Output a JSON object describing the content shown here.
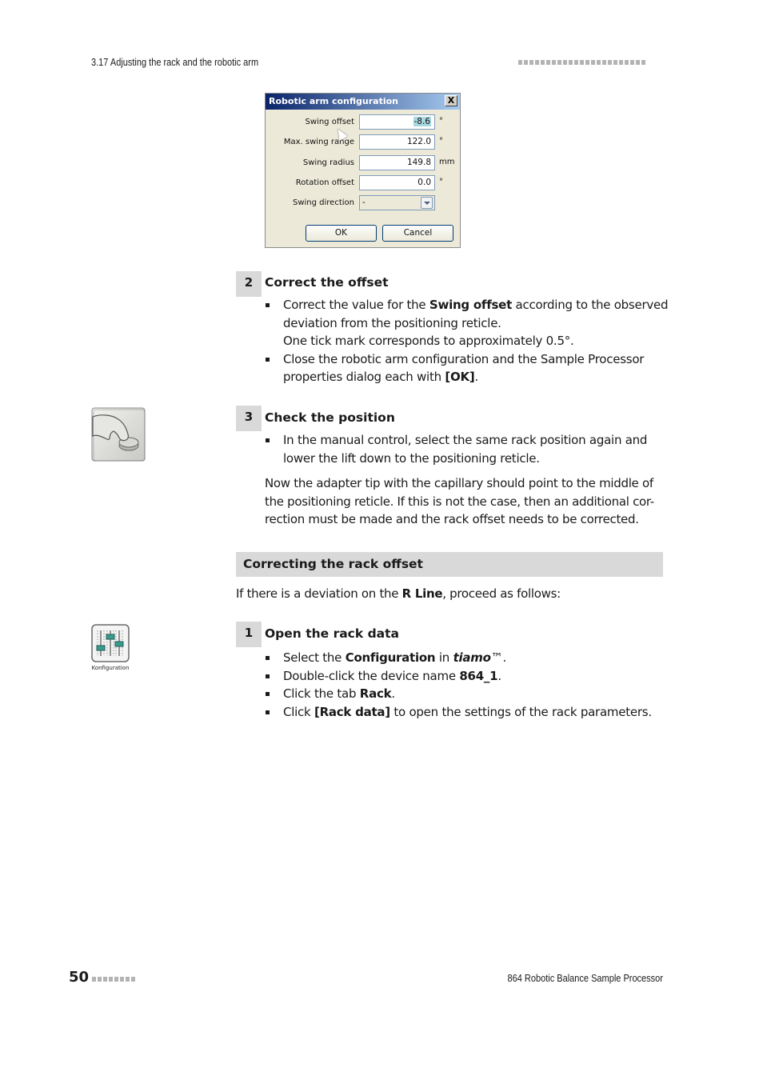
{
  "header": {
    "section_title": "3.17 Adjusting the rack and the robotic arm"
  },
  "dialog": {
    "title": "Robotic arm configuration",
    "close_label": "X",
    "fields": [
      {
        "label": "Swing offset",
        "value": "-8.6",
        "unit": "°",
        "selected": true
      },
      {
        "label": "Max. swing range",
        "value": "122.0",
        "unit": "°"
      },
      {
        "label": "Swing radius",
        "value": "149.8",
        "unit": "mm"
      },
      {
        "label": "Rotation offset",
        "value": "0.0",
        "unit": "°"
      }
    ],
    "swing_direction": {
      "label": "Swing direction",
      "value": "-"
    },
    "ok_label": "OK",
    "cancel_label": "Cancel"
  },
  "steps_a": [
    {
      "number": "2",
      "title": "Correct the offset",
      "bullets": [
        {
          "pre": "Correct the value for the ",
          "bold": "Swing offset",
          "post": " according to the observed deviation from the positioning reticle.",
          "line2": "One tick mark corresponds to approximately 0.5°."
        },
        {
          "pre": "Close the robotic arm configuration and the Sample Processor properties dialog each with ",
          "bold": "[OK]",
          "post": "."
        }
      ]
    },
    {
      "number": "3",
      "title": "Check the position",
      "bullets": [
        {
          "text": "In the manual control, select the same rack position again and lower the lift down to the positioning reticle."
        }
      ],
      "paragraph": "Now the adapter tip with the capillary should point to the middle of the positioning reticle. If this is not the case, then an additional cor-rection must be made and the rack offset needs to be corrected."
    }
  ],
  "section": {
    "title": "Correcting the rack offset",
    "intro_pre": "If there is a deviation on the ",
    "intro_bold": "R Line",
    "intro_post": ", proceed as follows:"
  },
  "steps_b": [
    {
      "number": "1",
      "title": "Open the rack data",
      "bullets": [
        {
          "pre": "Select the ",
          "bold": "Configuration",
          "mid": " in ",
          "bolditalic": "tiamo",
          "post": "™."
        },
        {
          "pre": "Double-click the device name ",
          "bold": "864_1",
          "post": "."
        },
        {
          "pre": "Click the tab ",
          "bold": "Rack",
          "post": "."
        },
        {
          "pre": "Click ",
          "bold": "[Rack data]",
          "post": " to open the settings of the rack parameters."
        }
      ]
    }
  ],
  "icons": {
    "manual_control": "manual-control-hand-icon",
    "configuration": {
      "name": "configuration-sliders-icon",
      "caption": "Konfiguration"
    }
  },
  "footer": {
    "page_number": "50",
    "document_title": "864 Robotic Balance Sample Processor"
  }
}
